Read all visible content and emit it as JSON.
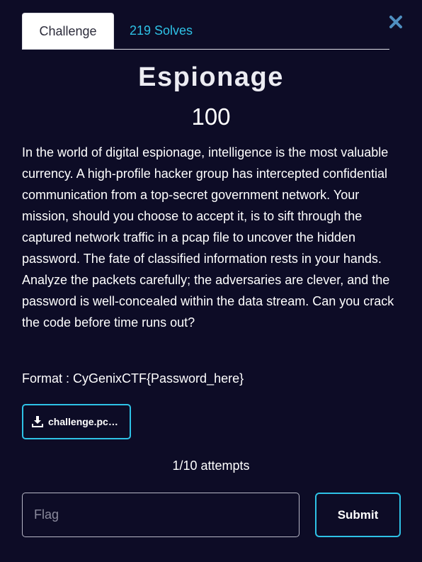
{
  "tabs": {
    "challenge_label": "Challenge",
    "solves_label": "219 Solves"
  },
  "colors": {
    "background": "#0d0c26",
    "accent": "#2ec2e6",
    "close_icon": "#4f8fc0"
  },
  "challenge": {
    "title": "Espionage",
    "points": "100",
    "description": "In the world of digital espionage, intelligence is the most valuable currency. A high-profile hacker group has intercepted confidential communication from a top-secret government network. Your mission, should you choose to accept it, is to sift through the captured network traffic in a pcap file to uncover the hidden password. The fate of classified information rests in your hands. Analyze the packets carefully; the adversaries are clever, and the password is well-concealed within the data stream. Can you crack the code before time runs out?",
    "format_prefix": "Format : CyGenixCTF{Password",
    "format_underscore": "_",
    "format_suffix": "here}"
  },
  "file": {
    "icon": "download-icon",
    "name": "challenge.pcap"
  },
  "attempts": "1/10 attempts",
  "submission": {
    "flag_placeholder": "Flag",
    "flag_value": "",
    "submit_label": "Submit"
  },
  "close_icon": "close-icon"
}
